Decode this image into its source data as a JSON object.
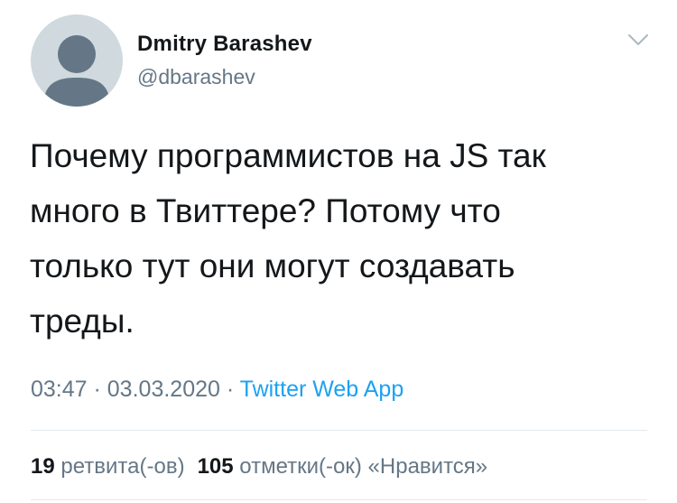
{
  "author": {
    "name": "Dmitry Barashev",
    "handle": "@dbarashev",
    "avatar_icon": "default-avatar-icon"
  },
  "menu_icon": "chevron-down-icon",
  "tweet": {
    "text": "Почему программистов на JS так\nмного в Твиттере? Потому что\nтолько тут они могут создавать\nтреды."
  },
  "meta": {
    "time": "03:47",
    "separator1": " · ",
    "date": "03.03.2020",
    "separator2": " · ",
    "source": "Twitter Web App"
  },
  "stats": {
    "retweets_count": "19",
    "retweets_label": "ретвита(-ов)",
    "likes_count": "105",
    "likes_label": "отметки(-ок) «Нравится»"
  },
  "colors": {
    "text": "#14171a",
    "secondary": "#657786",
    "link": "#1da1f2",
    "divider": "#e1e8ed",
    "avatar_bg": "#cfd9de",
    "avatar_fg": "#657786"
  }
}
